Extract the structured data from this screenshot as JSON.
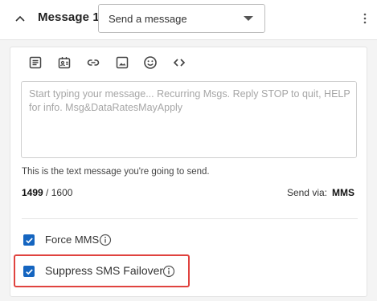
{
  "header": {
    "title": "Message 1",
    "dropdown": {
      "selected": "Send a message"
    }
  },
  "toolbar": {
    "icons": [
      "text-template-icon",
      "contact-card-icon",
      "link-icon",
      "image-icon",
      "emoji-icon",
      "code-icon"
    ]
  },
  "message": {
    "placeholder": "Start typing your message... Recurring Msgs. Reply STOP to quit, HELP for info. Msg&DataRatesMayApply",
    "helper": "This is the text message you're going to send.",
    "count_remaining": "1499",
    "count_separator": " / ",
    "count_max": "1600",
    "send_via_label": "Send via:",
    "send_via_value": "MMS"
  },
  "options": {
    "force_mms": {
      "label": "Force MMS",
      "checked": true
    },
    "suppress_failover": {
      "label": "Suppress SMS Failover",
      "checked": true
    }
  },
  "colors": {
    "checkbox": "#1565c0",
    "highlight": "#e0433f"
  }
}
